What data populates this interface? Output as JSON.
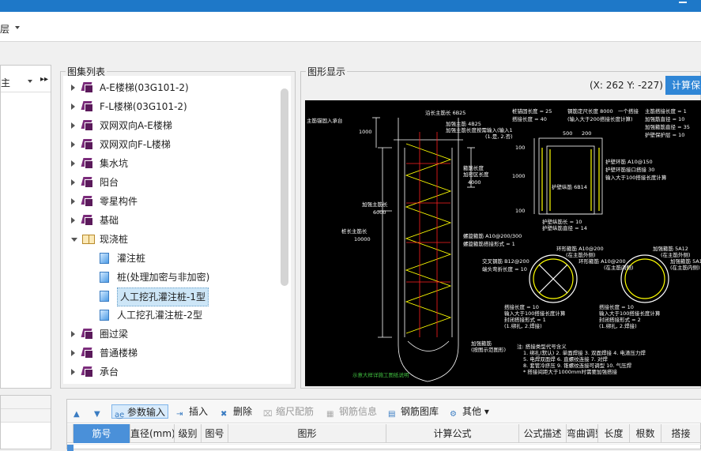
{
  "menubar": {
    "floor_label": "层"
  },
  "left_panel": {
    "header_label": "主",
    "filter_glyph": "▸▸"
  },
  "atlas_panel": {
    "title": "图集列表",
    "items": [
      {
        "label": "A-E楼梯(03G101-2)",
        "type": "book",
        "expanded": false
      },
      {
        "label": "F-L楼梯(03G101-2)",
        "type": "book",
        "expanded": false
      },
      {
        "label": "双网双向A-E楼梯",
        "type": "book",
        "expanded": false
      },
      {
        "label": "双网双向F-L楼梯",
        "type": "book",
        "expanded": false
      },
      {
        "label": "集水坑",
        "type": "book",
        "expanded": false
      },
      {
        "label": "阳台",
        "type": "book",
        "expanded": false
      },
      {
        "label": "零星构件",
        "type": "book",
        "expanded": false
      },
      {
        "label": "基础",
        "type": "book",
        "expanded": false
      },
      {
        "label": "现浇桩",
        "type": "openbook",
        "expanded": true
      },
      {
        "label": "灌注桩",
        "type": "page",
        "child": true
      },
      {
        "label": "桩(处理加密与非加密)",
        "type": "page",
        "child": true
      },
      {
        "label": "人工挖孔灌注桩-1型",
        "type": "page",
        "child": true,
        "selected": true
      },
      {
        "label": "人工挖孔灌注桩-2型",
        "type": "page",
        "child": true
      },
      {
        "label": "圈过梁",
        "type": "book",
        "expanded": false
      },
      {
        "label": "普通楼梯",
        "type": "book",
        "expanded": false
      },
      {
        "label": "承台",
        "type": "book",
        "expanded": false
      }
    ]
  },
  "figure_panel": {
    "title": "图形显示",
    "coords": "(X: 262 Y: -227)",
    "calc_button": "计算保"
  },
  "drawing": {
    "texts": {
      "t1": "主筋锚固入承台",
      "t2": "1000",
      "t3": "沿长主筋长 6B25",
      "t4": "加强主筋 4B25",
      "t5": "加强主筋长度按需输入(输入1",
      "t6": "(1.是, 2.否)",
      "t7": "箍筋长度",
      "t8": "加密区长度",
      "t9": "4000",
      "t10": "加强主筋长",
      "t11": "6000",
      "t12": "桩长主筋长",
      "t13": "10000",
      "t14": "螺旋箍筋 A10@200/300",
      "t15": "螺旋箍筋搭接形式 = 1",
      "t16": "加强箍筋",
      "t17": "(按图示范图形)",
      "t18": "桩锚固长度 = 25",
      "t19": "钢筋定尺长度 8000",
      "t20": "一个搭接",
      "t21": "主筋搭接长度 = 1",
      "t22": "搭接长度 = 40",
      "t23": "(输入大于200搭接长度计算)",
      "t24": "加强筋直径 = 10",
      "t25": "加强箍筋直径 = 35",
      "t26": "护壁保护层 = 10",
      "t27": "500",
      "t28": "200",
      "t29": "100",
      "t30": "1000",
      "t31": "100",
      "t32": "护壁环筋 A10@150",
      "t33": "护壁环筋接口搭接 30",
      "t34": "输入大于100搭接长度计算",
      "t35": "护壁纵筋 6B14",
      "t36": "护壁纵筋长 = 10",
      "t37": "护壁纵筋直径 = 14",
      "t38": "环形箍筋 A10@200",
      "t39": "(在主筋外侧)",
      "t40": "交叉钢筋 B12@200",
      "t41": "端头弯折长度 = 10",
      "t42": "环形箍筋 A10@200",
      "t43": "(在主筋内侧)",
      "t44": "加强箍筋 5A12",
      "t45": "(在主筋外侧)",
      "t46": "加强箍筋 5A1",
      "t47": "(在主筋内侧)",
      "t48": "搭接长度 = 10",
      "t49": "输入大于100搭接长度计算",
      "t50": "封闭搭接形式 = 1",
      "t51": "(1.绑扎, 2.焊接)",
      "t52": "搭接长度 = 10",
      "t53": "输入大于100搭接长度计算",
      "t54": "封闭搭接形式 = 2",
      "t55": "(1.绑扎, 2.焊接)",
      "t56": "注: 搭接类型代号含义",
      "t57": "1. 绑扎(默认)  2. 单面焊接  3. 双面焊接  4. 电渣压力焊",
      "t58": "5. 电焊双面焊  6. 直螺纹连接  7. 对焊",
      "t59": "8. 套管冷挤压  9. 锥螺纹连接可调型  10. 气压焊",
      "t60": "* 搭接间距大于1000mm时需要加强搭接",
      "t61": "示意大样详施工图纸说明"
    }
  },
  "toolbar": {
    "buttons": [
      {
        "label": "",
        "icon": "move-up-icon",
        "enabled": true
      },
      {
        "label": "",
        "icon": "move-down-icon",
        "enabled": true
      },
      {
        "label": "参数输入",
        "icon": "param-input-icon",
        "enabled": true,
        "active": true
      },
      {
        "label": "插入",
        "icon": "insert-icon",
        "enabled": true
      },
      {
        "label": "删除",
        "icon": "delete-icon",
        "enabled": true
      },
      {
        "label": "缩尺配筋",
        "icon": "scale-rebar-icon",
        "enabled": false
      },
      {
        "label": "钢筋信息",
        "icon": "rebar-info-icon",
        "enabled": false
      },
      {
        "label": "钢筋图库",
        "icon": "rebar-library-icon",
        "enabled": true
      },
      {
        "label": "其他",
        "icon": "other-icon",
        "enabled": true
      }
    ]
  },
  "grid": {
    "columns": [
      "筋号",
      "直径(mm)",
      "级别",
      "图号",
      "图形",
      "计算公式",
      "公式描述",
      "弯曲调整",
      "长度",
      "根数",
      "搭接"
    ]
  },
  "colors": {
    "title_bar": "#1e78c8",
    "accent_button": "#2f86d6",
    "tree_selection": "#cde6f7",
    "drawing_bg": "#000000",
    "drawing_line": "#ffffff",
    "rebar_yellow": "#ffff00",
    "rebar_red": "#ff2020"
  }
}
